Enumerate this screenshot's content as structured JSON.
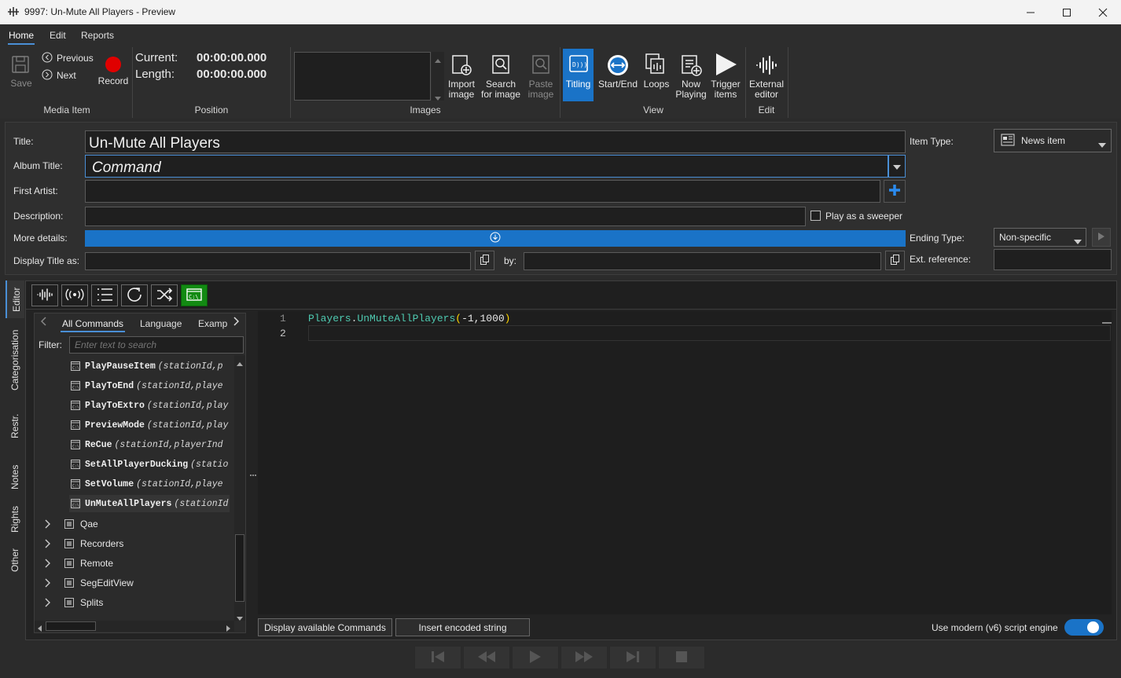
{
  "window": {
    "title": "9997: Un-Mute All Players  - Preview"
  },
  "ribbon": {
    "tabs": [
      {
        "label": "Home"
      },
      {
        "label": "Edit"
      },
      {
        "label": "Reports"
      }
    ],
    "media_item": {
      "save": "Save",
      "previous": "Previous",
      "next": "Next",
      "record": "Record",
      "group": "Media Item"
    },
    "position": {
      "current_label": "Current:",
      "current_value": "00:00:00.000",
      "length_label": "Length:",
      "length_value": "00:00:00.000",
      "group": "Position"
    },
    "images": {
      "import": "Import image",
      "search": "Search for image",
      "paste": "Paste image",
      "group": "Images"
    },
    "view": {
      "titling": "Titling",
      "start_end": "Start/End",
      "loops": "Loops",
      "now_playing": "Now Playing",
      "trigger": "Trigger items",
      "group": "View"
    },
    "edit": {
      "external": "External editor",
      "group": "Edit"
    }
  },
  "form": {
    "title_label": "Title:",
    "title_value": "Un-Mute All Players",
    "album_label": "Album Title:",
    "album_value": "Command",
    "artist_label": "First Artist:",
    "description_label": "Description:",
    "sweeper_label": "Play as a sweeper",
    "more_details_label": "More details:",
    "display_title_label": "Display Title as:",
    "by_label": "by:",
    "item_type_label": "Item Type:",
    "item_type_value": "News item",
    "ending_type_label": "Ending Type:",
    "ending_type_value": "Non-specific",
    "ext_ref_label": "Ext. reference:"
  },
  "side_tabs": [
    {
      "label": "Editor"
    },
    {
      "label": "Categorisation"
    },
    {
      "label": "Restr."
    },
    {
      "label": "Notes"
    },
    {
      "label": "Rights"
    },
    {
      "label": "Other"
    }
  ],
  "commands_panel": {
    "tabs": [
      {
        "label": "All Commands"
      },
      {
        "label": "Language"
      },
      {
        "label": "Examp"
      }
    ],
    "filter_label": "Filter:",
    "filter_placeholder": "Enter text to search",
    "commands": [
      {
        "name": "PlayPauseItem",
        "args": "(stationId,p"
      },
      {
        "name": "PlayToEnd",
        "args": "(stationId,playe"
      },
      {
        "name": "PlayToExtro",
        "args": "(stationId,play"
      },
      {
        "name": "PreviewMode",
        "args": "(stationId,play"
      },
      {
        "name": "ReCue",
        "args": "(stationId,playerInd"
      },
      {
        "name": "SetAllPlayerDucking",
        "args": "(statio"
      },
      {
        "name": "SetVolume",
        "args": "(stationId,playe"
      },
      {
        "name": "UnMuteAllPlayers",
        "args": "(stationId"
      }
    ],
    "groups": [
      {
        "label": "Qae"
      },
      {
        "label": "Recorders"
      },
      {
        "label": "Remote"
      },
      {
        "label": "SegEditView"
      },
      {
        "label": "Splits"
      }
    ]
  },
  "code": {
    "lines": [
      {
        "num": "1",
        "obj": "Players",
        "dot": ".",
        "method": "UnMuteAllPlayers",
        "open": "(",
        "args": "-1,1000",
        "close": ")"
      },
      {
        "num": "2"
      }
    ]
  },
  "footer": {
    "display_commands": "Display available Commands",
    "insert_encoded": "Insert encoded string",
    "modern_engine_label": "Use modern (v6) script engine",
    "modern_engine_on": true
  }
}
